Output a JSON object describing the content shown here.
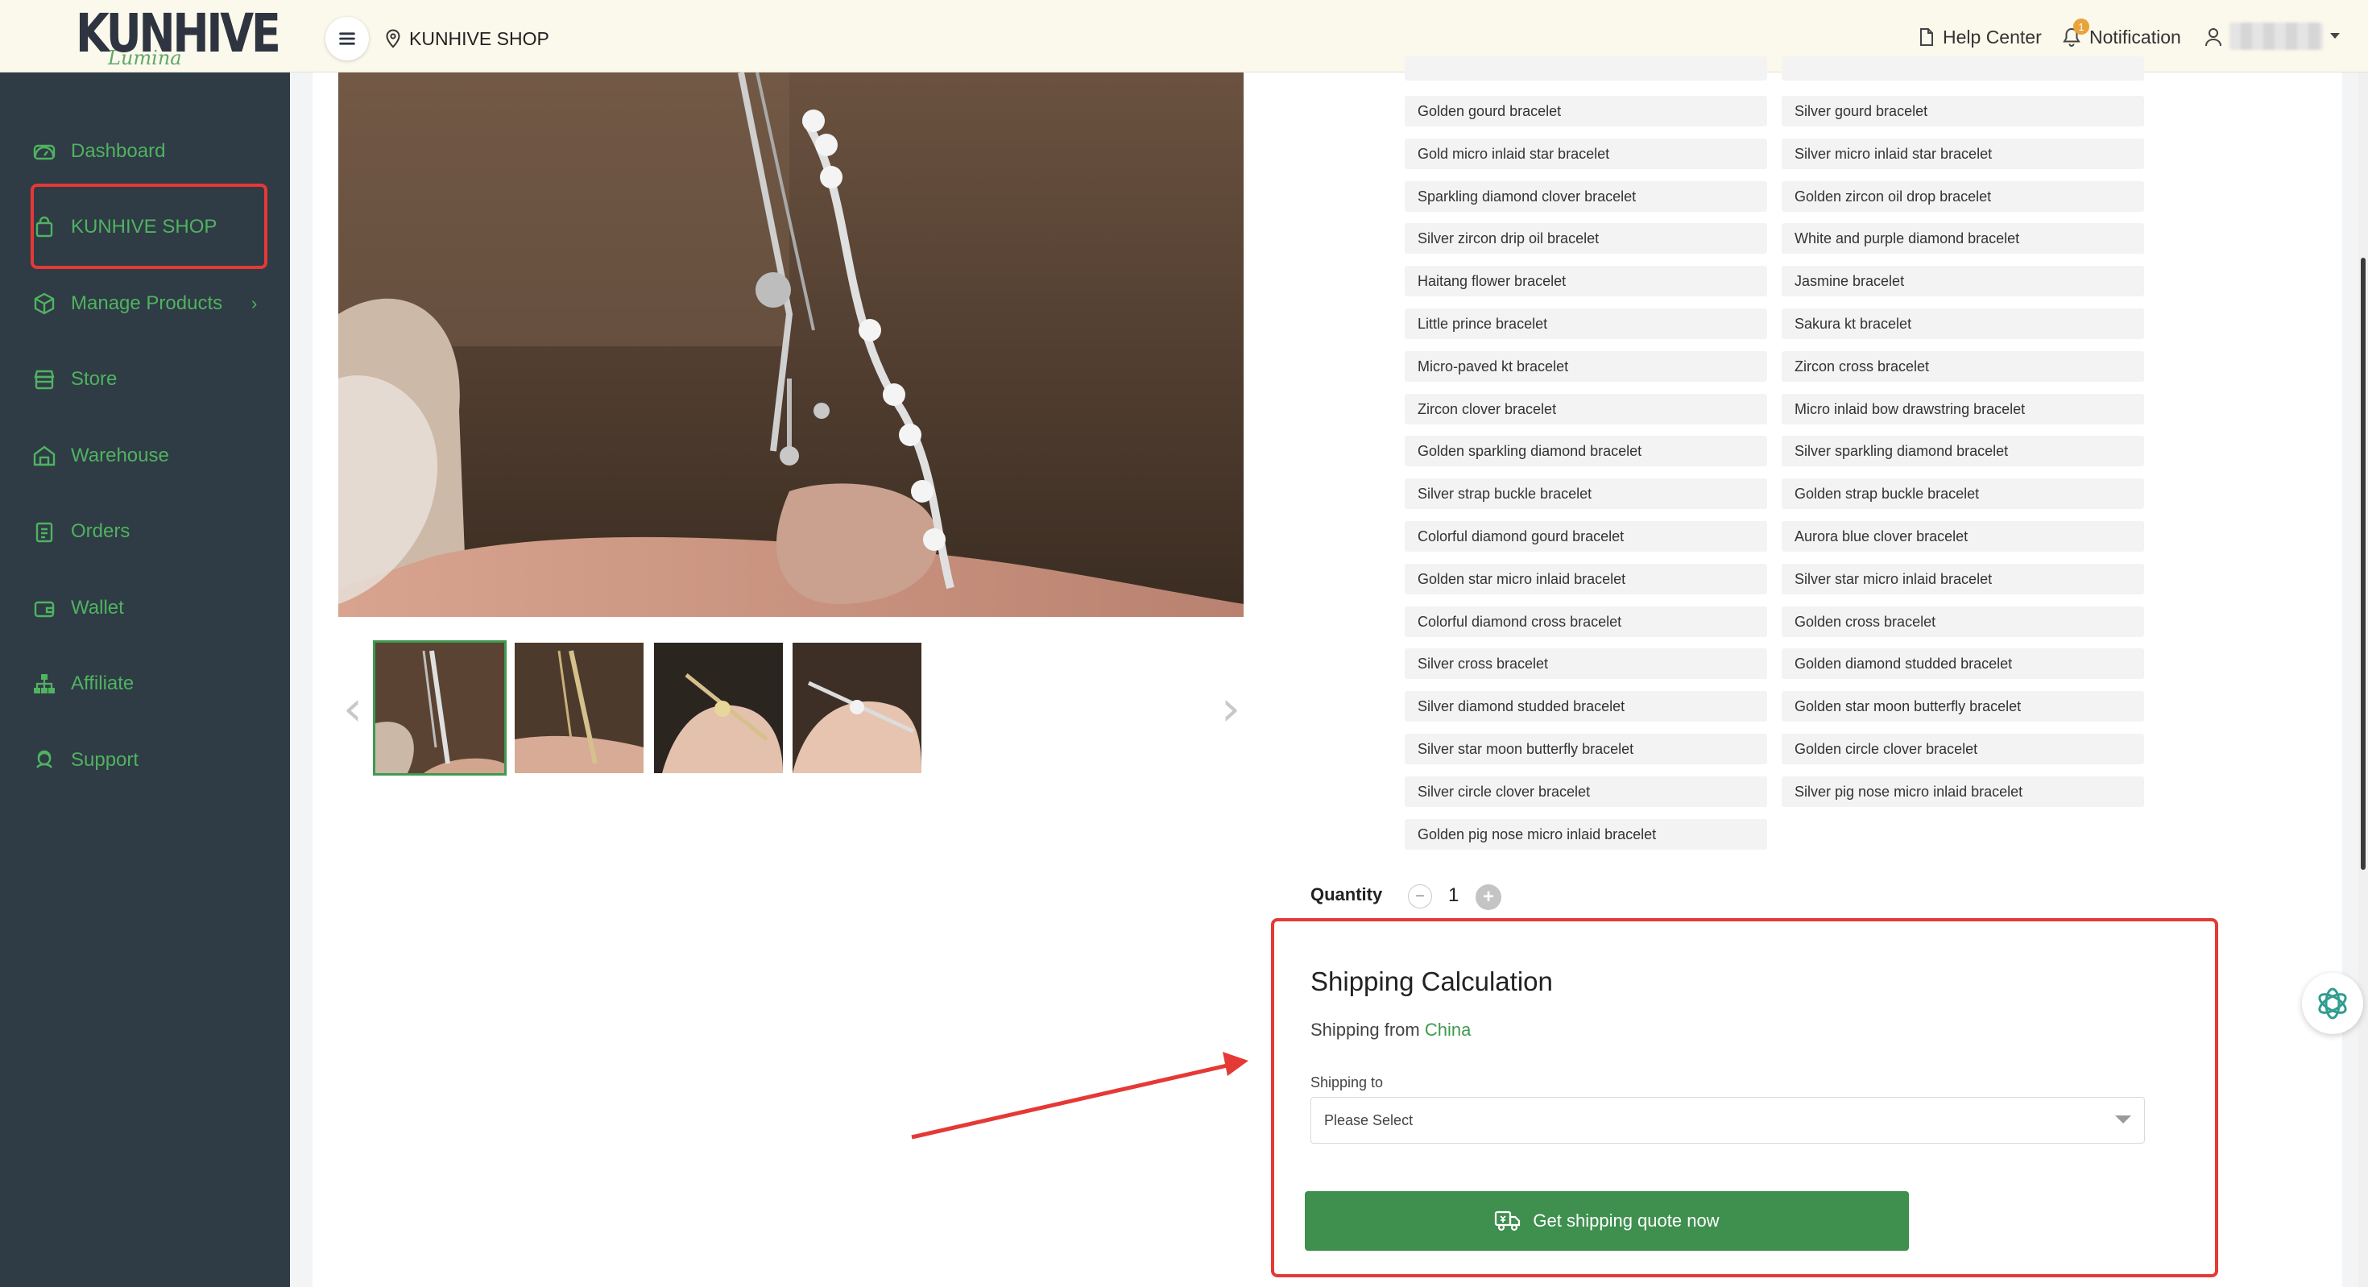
{
  "brand": {
    "logo_text": "KUNHIVE",
    "logo_script": "Lumina"
  },
  "header": {
    "shop_name": "KUNHIVE SHOP",
    "help_center": "Help Center",
    "notification": "Notification",
    "notification_count": "1"
  },
  "sidebar": {
    "items": [
      {
        "label": "Dashboard",
        "icon": "gauge-icon"
      },
      {
        "label": "KUNHIVE SHOP",
        "icon": "shopping-bag-icon",
        "highlighted": true
      },
      {
        "label": "Manage Products",
        "icon": "box-icon",
        "has_submenu": true
      },
      {
        "label": "Store",
        "icon": "storefront-icon"
      },
      {
        "label": "Warehouse",
        "icon": "warehouse-icon"
      },
      {
        "label": "Orders",
        "icon": "clipboard-icon"
      },
      {
        "label": "Wallet",
        "icon": "wallet-icon"
      },
      {
        "label": "Affiliate",
        "icon": "network-icon"
      },
      {
        "label": "Support",
        "icon": "support-icon"
      }
    ]
  },
  "product": {
    "variants_left": [
      "Golden gourd bracelet",
      "Gold micro inlaid star bracelet",
      "Sparkling diamond clover bracelet",
      "Silver zircon drip oil bracelet",
      "Haitang flower bracelet",
      "Little prince bracelet",
      "Micro-paved kt bracelet",
      "Zircon clover bracelet",
      "Golden sparkling diamond bracelet",
      "Silver strap buckle bracelet",
      "Colorful diamond gourd bracelet",
      "Golden star micro inlaid bracelet",
      "Colorful diamond cross bracelet",
      "Silver cross bracelet",
      "Silver diamond studded bracelet",
      "Silver star moon butterfly bracelet",
      "Silver circle clover bracelet",
      "Golden pig nose micro inlaid bracelet"
    ],
    "variants_right": [
      "Silver gourd bracelet",
      "Silver micro inlaid star bracelet",
      "Golden zircon oil drop bracelet",
      "White and purple diamond bracelet",
      "Jasmine bracelet",
      "Sakura kt bracelet",
      "Zircon cross bracelet",
      "Micro inlaid bow drawstring bracelet",
      "Silver sparkling diamond bracelet",
      "Golden strap buckle bracelet",
      "Aurora blue clover bracelet",
      "Silver star micro inlaid bracelet",
      "Golden cross bracelet",
      "Golden diamond studded bracelet",
      "Golden star moon butterfly bracelet",
      "Golden circle clover bracelet",
      "Silver pig nose micro inlaid bracelet"
    ],
    "quantity_label": "Quantity",
    "quantity_value": "1",
    "thumbnail_count": 4
  },
  "shipping": {
    "title": "Shipping Calculation",
    "from_prefix": "Shipping from",
    "from_country": "China",
    "to_label": "Shipping to",
    "to_placeholder": "Please Select",
    "quote_button": "Get shipping quote now"
  },
  "colors": {
    "accent_green": "#3f8f4f",
    "sidebar_bg": "#2f3b45",
    "sidebar_text": "#4fb360",
    "annotation_red": "#e53935",
    "header_bg": "#fbf8ec"
  }
}
